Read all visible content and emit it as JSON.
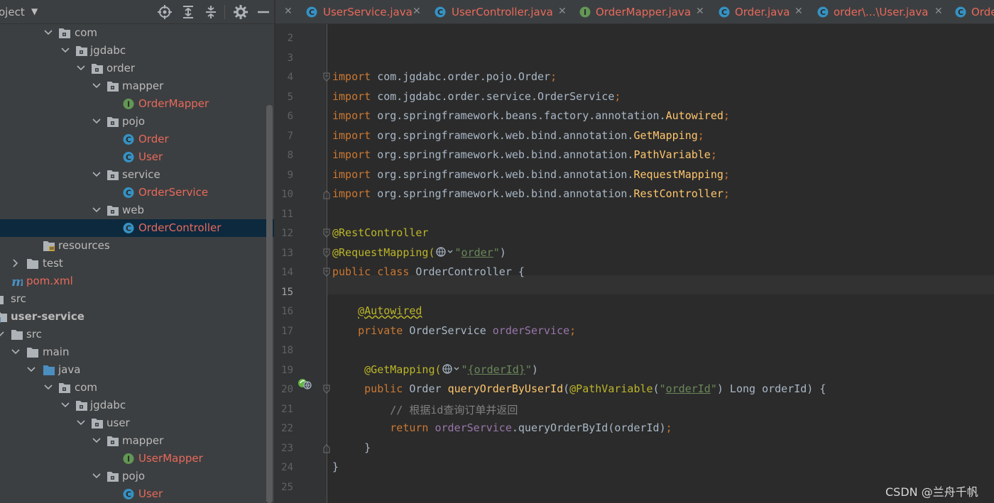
{
  "project_panel": {
    "title": "oject",
    "toolbar": [
      "locate-icon",
      "expand-all-icon",
      "collapse-all-icon",
      "gear-icon",
      "minimize-icon"
    ],
    "tree": [
      {
        "label": "com",
        "type": "package",
        "expanded": true,
        "color": "normal"
      },
      {
        "label": "jgdabc",
        "type": "package",
        "expanded": true,
        "color": "normal"
      },
      {
        "label": "order",
        "type": "package",
        "expanded": true,
        "color": "normal"
      },
      {
        "label": "mapper",
        "type": "package",
        "expanded": true,
        "color": "normal"
      },
      {
        "label": "OrderMapper",
        "type": "interface",
        "color": "red"
      },
      {
        "label": "pojo",
        "type": "package",
        "expanded": true,
        "color": "normal"
      },
      {
        "label": "Order",
        "type": "class",
        "color": "red"
      },
      {
        "label": "User",
        "type": "class",
        "color": "red"
      },
      {
        "label": "service",
        "type": "package",
        "expanded": true,
        "color": "normal"
      },
      {
        "label": "OrderService",
        "type": "class",
        "color": "red"
      },
      {
        "label": "web",
        "type": "package",
        "expanded": true,
        "color": "normal"
      },
      {
        "label": "OrderController",
        "type": "class",
        "color": "red",
        "selected": true
      },
      {
        "label": "resources",
        "type": "resources",
        "color": "normal"
      },
      {
        "label": "test",
        "type": "folder",
        "expanded": false,
        "color": "normal"
      },
      {
        "label": "pom.xml",
        "type": "maven",
        "color": "red"
      },
      {
        "label": "src",
        "type": "folder",
        "color": "normal"
      },
      {
        "label": "user-service",
        "type": "module",
        "expanded": true,
        "color": "bold"
      },
      {
        "label": "src",
        "type": "folder",
        "expanded": true,
        "color": "normal"
      },
      {
        "label": "main",
        "type": "folder",
        "expanded": true,
        "color": "normal"
      },
      {
        "label": "java",
        "type": "source-folder",
        "expanded": true,
        "color": "normal"
      },
      {
        "label": "com",
        "type": "package",
        "expanded": true,
        "color": "normal"
      },
      {
        "label": "jgdabc",
        "type": "package",
        "expanded": true,
        "color": "normal"
      },
      {
        "label": "user",
        "type": "package",
        "expanded": true,
        "color": "normal"
      },
      {
        "label": "mapper",
        "type": "package",
        "expanded": true,
        "color": "normal"
      },
      {
        "label": "UserMapper",
        "type": "interface",
        "color": "red"
      },
      {
        "label": "pojo",
        "type": "package",
        "expanded": true,
        "color": "normal"
      },
      {
        "label": "User",
        "type": "class",
        "color": "red"
      }
    ]
  },
  "tabs": [
    {
      "label": "UserService.java",
      "icon": "class-icon"
    },
    {
      "label": "UserController.java",
      "icon": "class-icon"
    },
    {
      "label": "OrderMapper.java",
      "icon": "interface-icon"
    },
    {
      "label": "Order.java",
      "icon": "class-icon"
    },
    {
      "label": "order\\...\\User.java",
      "icon": "class-icon"
    },
    {
      "label": "Orde",
      "icon": "class-icon"
    }
  ],
  "editor": {
    "current_line": "15",
    "lines": [
      {
        "n": "2",
        "tokens": []
      },
      {
        "n": "3",
        "tokens": []
      },
      {
        "n": "4",
        "tokens": [
          {
            "t": "import ",
            "c": "kw"
          },
          {
            "t": "com.jgdabc.order.pojo.Order",
            "c": ""
          },
          {
            "t": ";",
            "c": "kw"
          }
        ]
      },
      {
        "n": "5",
        "tokens": [
          {
            "t": "import ",
            "c": "kw"
          },
          {
            "t": "com.jgdabc.order.service.OrderService",
            "c": ""
          },
          {
            "t": ";",
            "c": "kw"
          }
        ]
      },
      {
        "n": "6",
        "tokens": [
          {
            "t": "import ",
            "c": "kw"
          },
          {
            "t": "org.springframework.beans.factory.annotation.",
            "c": ""
          },
          {
            "t": "Autowired",
            "c": "mth"
          },
          {
            "t": ";",
            "c": "kw"
          }
        ]
      },
      {
        "n": "7",
        "tokens": [
          {
            "t": "import ",
            "c": "kw"
          },
          {
            "t": "org.springframework.web.bind.annotation.",
            "c": ""
          },
          {
            "t": "GetMapping",
            "c": "mth"
          },
          {
            "t": ";",
            "c": "kw"
          }
        ]
      },
      {
        "n": "8",
        "tokens": [
          {
            "t": "import ",
            "c": "kw"
          },
          {
            "t": "org.springframework.web.bind.annotation.",
            "c": ""
          },
          {
            "t": "PathVariable",
            "c": "mth"
          },
          {
            "t": ";",
            "c": "kw"
          }
        ]
      },
      {
        "n": "9",
        "tokens": [
          {
            "t": "import ",
            "c": "kw"
          },
          {
            "t": "org.springframework.web.bind.annotation.",
            "c": ""
          },
          {
            "t": "RequestMapping",
            "c": "mth"
          },
          {
            "t": ";",
            "c": "kw"
          }
        ]
      },
      {
        "n": "10",
        "tokens": [
          {
            "t": "import ",
            "c": "kw"
          },
          {
            "t": "org.springframework.web.bind.annotation.",
            "c": ""
          },
          {
            "t": "RestController",
            "c": "mth"
          },
          {
            "t": ";",
            "c": "kw"
          }
        ]
      },
      {
        "n": "11",
        "tokens": []
      },
      {
        "n": "12",
        "tokens": [
          {
            "t": "@RestController",
            "c": "an"
          }
        ]
      },
      {
        "n": "13",
        "tokens": [
          {
            "t": "@RequestMapping(",
            "c": "an"
          },
          {
            "t": "",
            "c": "globe"
          },
          {
            "t": "\"",
            "c": "str"
          },
          {
            "t": "order",
            "c": "str u"
          },
          {
            "t": "\"",
            "c": "str"
          },
          {
            "t": ")",
            "c": ""
          }
        ]
      },
      {
        "n": "14",
        "tokens": [
          {
            "t": "public class ",
            "c": "kw"
          },
          {
            "t": "OrderController {",
            "c": ""
          }
        ]
      },
      {
        "n": "15",
        "tokens": []
      },
      {
        "n": "16",
        "tokens": [
          {
            "t": "    ",
            "c": ""
          },
          {
            "t": "@Autowired",
            "c": "an wavy"
          }
        ]
      },
      {
        "n": "17",
        "tokens": [
          {
            "t": "    ",
            "c": ""
          },
          {
            "t": "private ",
            "c": "kw"
          },
          {
            "t": "OrderService ",
            "c": ""
          },
          {
            "t": "orderService",
            "c": "fld"
          },
          {
            "t": ";",
            "c": "kw"
          }
        ]
      },
      {
        "n": "18",
        "tokens": []
      },
      {
        "n": "19",
        "tokens": [
          {
            "t": "     ",
            "c": ""
          },
          {
            "t": "@GetMapping(",
            "c": "an"
          },
          {
            "t": "",
            "c": "globe"
          },
          {
            "t": "\"",
            "c": "str"
          },
          {
            "t": "{orderId}",
            "c": "str u"
          },
          {
            "t": "\"",
            "c": "str"
          },
          {
            "t": ")",
            "c": ""
          }
        ]
      },
      {
        "n": "20",
        "tokens": [
          {
            "t": "     ",
            "c": ""
          },
          {
            "t": "public ",
            "c": "kw"
          },
          {
            "t": "Order ",
            "c": ""
          },
          {
            "t": "queryOrderByUserId",
            "c": "mth"
          },
          {
            "t": "(",
            "c": ""
          },
          {
            "t": "@PathVariable",
            "c": "an"
          },
          {
            "t": "(",
            "c": ""
          },
          {
            "t": "\"",
            "c": "str"
          },
          {
            "t": "orderId",
            "c": "str u"
          },
          {
            "t": "\"",
            "c": "str"
          },
          {
            "t": ") Long orderId) {",
            "c": ""
          }
        ]
      },
      {
        "n": "21",
        "tokens": [
          {
            "t": "         ",
            "c": ""
          },
          {
            "t": "// 根据id查询订单并返回",
            "c": "cmt"
          }
        ]
      },
      {
        "n": "22",
        "tokens": [
          {
            "t": "         ",
            "c": ""
          },
          {
            "t": "return ",
            "c": "kw"
          },
          {
            "t": "orderService",
            "c": "fld"
          },
          {
            "t": ".queryOrderById(orderId)",
            "c": ""
          },
          {
            "t": ";",
            "c": "kw"
          }
        ]
      },
      {
        "n": "23",
        "tokens": [
          {
            "t": "     ",
            "c": ""
          },
          {
            "t": "}",
            "c": ""
          }
        ]
      },
      {
        "n": "24",
        "tokens": [
          {
            "t": "}",
            "c": ""
          }
        ]
      },
      {
        "n": "25",
        "tokens": []
      }
    ]
  },
  "watermark": "CSDN @兰舟千帆",
  "colors": {
    "panel_bg": "#3c3f41",
    "editor_bg": "#2b2b2b",
    "selection_bg": "#0d293e",
    "changed_file_red": "#e8695b",
    "keyword": "#cc7832",
    "annotation": "#bbb529",
    "string": "#6a8759",
    "field": "#9876aa",
    "method": "#ffc66d",
    "comment": "#808080"
  }
}
